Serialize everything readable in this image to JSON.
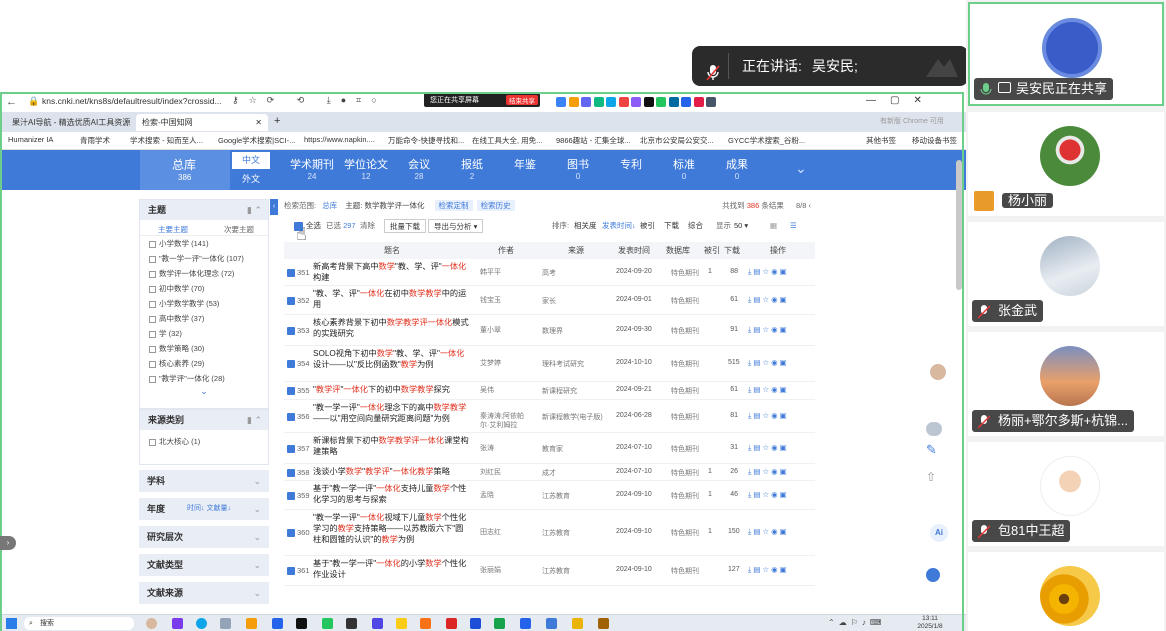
{
  "meeting": {
    "speaking_label": "正在讲话:",
    "speaking_name": "吴安民;",
    "participants": [
      {
        "name": "吴安民正在共享",
        "avatar": "blue-circle-avatar",
        "active": true
      },
      {
        "name": "杨小丽",
        "avatar": "mushroom-photo"
      },
      {
        "name": "张金武",
        "avatar": "snow-mountain-photo"
      },
      {
        "name": "杨丽+鄂尔多斯+杭锦...",
        "avatar": "sunset-photo"
      },
      {
        "name": "包81中王超",
        "avatar": "cartoon-man-avatar"
      },
      {
        "name": "",
        "avatar": "sunflower-photo"
      }
    ]
  },
  "browser": {
    "url": "kns.cnki.net/kns8s/defaultresult/index?crossid...",
    "share_bar": {
      "label": "您正在共享屏幕",
      "stop": "结束共享"
    },
    "tabs": [
      {
        "label": "果汁AI导航 - 精选优质AI工具资源"
      },
      {
        "label": "检索-中国知网"
      }
    ],
    "bookmarks": [
      "Humanizer IA",
      "青雨学术",
      "学术搜索 - 知而至人...",
      "Google学术搜索|SCI-...",
      "https://www.napkin....",
      "万能命令-快捷寻找和...",
      "在线工具大全, 用免...",
      "9866趣站 - 汇集全球...",
      "北京市公安局公安交...",
      "GYCC学术搜索_谷粉..."
    ],
    "bookmarks_right": [
      "其他书签",
      "移动设备书签"
    ],
    "update_btn": "有新版 Chrome 可用"
  },
  "cnki": {
    "total": {
      "label": "总库",
      "count": "386"
    },
    "lang": [
      "中文",
      "外文"
    ],
    "nav": [
      {
        "label": "学术期刊",
        "count": "24"
      },
      {
        "label": "学位论文",
        "count": "12"
      },
      {
        "label": "会议",
        "count": "28"
      },
      {
        "label": "报纸",
        "count": "2"
      },
      {
        "label": "年鉴",
        "count": ""
      },
      {
        "label": "图书",
        "count": "0"
      },
      {
        "label": "专利",
        "count": ""
      },
      {
        "label": "标准",
        "count": "0"
      },
      {
        "label": "成果",
        "count": "0"
      }
    ],
    "sidebar": {
      "topic_title": "主题",
      "topic_tabs": [
        "主要主题",
        "次要主题"
      ],
      "topics": [
        "小学数学 (141)",
        "\"教一学一评\"一体化 (107)",
        "数学评一体化理念 (72)",
        "初中数学 (70)",
        "小学数学教学 (53)",
        "高中数学 (37)",
        "学 (32)",
        "数学策略 (30)",
        "核心素养 (29)",
        "\"教学评\"一体化 (28)"
      ],
      "source_title": "来源类别",
      "sources": [
        "北大核心 (1)"
      ],
      "groups": [
        "学科",
        "年度",
        "研究层次",
        "文献类型",
        "文献来源"
      ],
      "year_extra": "时间↓ 文献量↓"
    },
    "search_info": {
      "scope_label": "检索范围:",
      "scope": "总库",
      "topic_label": "主题: 数学教学评一体化",
      "custom": "检索定制",
      "history": "检索历史",
      "found_label": "共找到",
      "found": "386",
      "found_unit": "条结果",
      "page": "8/8"
    },
    "toolbar": {
      "select_all": "全选",
      "selected": "已选",
      "selected_count": "297",
      "clear": "清除",
      "batch_download": "批量下载",
      "export": "导出与分析",
      "sort_label": "排序:",
      "sort_options": [
        "相关度",
        "发表时间↓",
        "被引",
        "下载",
        "综合"
      ],
      "show_label": "显示",
      "show_count": "50"
    },
    "columns": [
      "题名",
      "作者",
      "来源",
      "发表时间",
      "数据库",
      "被引",
      "下载",
      "操作"
    ],
    "rows": [
      {
        "no": "351",
        "title": "新高考背景下高中数学\"教、学、评\"一体化构建",
        "author": "韩平平",
        "source": "高考",
        "date": "2024-09-20",
        "db": "特色期刊",
        "cite": "1",
        "dl": "88"
      },
      {
        "no": "352",
        "title": "\"教、学、评\"一体化在初中数学教学中的运用",
        "author": "钱宝玉",
        "source": "家长",
        "date": "2024-09-01",
        "db": "特色期刊",
        "cite": "",
        "dl": "61"
      },
      {
        "no": "353",
        "title": "核心素养背景下初中数学教学评一体化模式的实践研究",
        "author": "董小翠",
        "source": "数理界",
        "date": "2024-09-30",
        "db": "特色期刊",
        "cite": "",
        "dl": "91"
      },
      {
        "no": "354",
        "title": "SOLO视角下初中数学\"教、学、评\"一体化设计——以\"反比例函数\"教学为例",
        "author": "艾梦婷",
        "source": "理科考试研究",
        "date": "2024-10-10",
        "db": "特色期刊",
        "cite": "",
        "dl": "515"
      },
      {
        "no": "355",
        "title": "\"教学评\"一体化下的初中数学教学探究",
        "author": "吴伟",
        "source": "新课程研究",
        "date": "2024-09-21",
        "db": "特色期刊",
        "cite": "",
        "dl": "61"
      },
      {
        "no": "356",
        "title": "\"教一学一评\"一体化理念下的高中数学教学——以\"用空间向量研究距离问题\"为例",
        "author": "秦涛涛;阿依帕尔·艾利姆拉",
        "source": "新课程教学(电子版)",
        "date": "2024-06-28",
        "db": "特色期刊",
        "cite": "",
        "dl": "81"
      },
      {
        "no": "357",
        "title": "新课标背景下初中数学教学评一体化课堂构建策略",
        "author": "张涛",
        "source": "教育家",
        "date": "2024-07-10",
        "db": "特色期刊",
        "cite": "",
        "dl": "31"
      },
      {
        "no": "358",
        "title": "浅谈小学数学\"教学评\"一体化教学策略",
        "author": "刘红民",
        "source": "成才",
        "date": "2024-07-10",
        "db": "特色期刊",
        "cite": "1",
        "dl": "26"
      },
      {
        "no": "359",
        "title": "基于\"教一学一评\"一体化支持儿童数学个性化学习的思考与探索",
        "author": "孟晓",
        "source": "江苏教育",
        "date": "2024-09-10",
        "db": "特色期刊",
        "cite": "1",
        "dl": "46"
      },
      {
        "no": "360",
        "title": "\"教一学一评\"一体化视域下儿童数学个性化学习的教学支持策略——以苏教版六下\"圆柱和圆锥的认识\"的教学为例",
        "author": "田志红",
        "source": "江苏教育",
        "date": "2024-09-10",
        "db": "特色期刊",
        "cite": "1",
        "dl": "150"
      },
      {
        "no": "361",
        "title": "基于\"教一学一评\"一体化的小学数学个性化作业设计",
        "author": "张丽娟",
        "source": "江苏教育",
        "date": "2024-09-10",
        "db": "特色期刊",
        "cite": "",
        "dl": "127"
      }
    ]
  },
  "taskbar": {
    "search": "搜索",
    "time": "13:11",
    "date": "2025/1/8"
  }
}
